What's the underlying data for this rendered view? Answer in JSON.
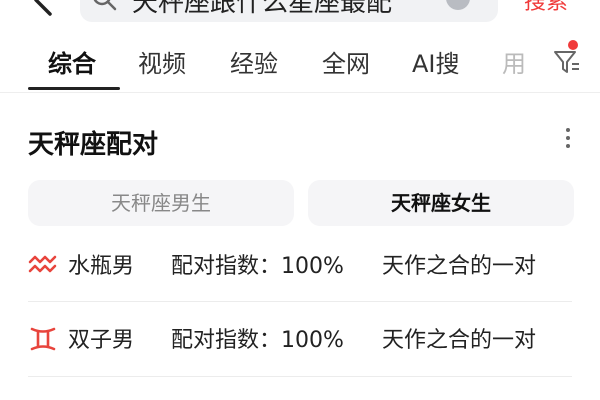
{
  "search": {
    "query": "天秤座跟什么星座最配",
    "button_label": "搜索"
  },
  "tabs": [
    {
      "label": "综合"
    },
    {
      "label": "视频"
    },
    {
      "label": "经验"
    },
    {
      "label": "全网"
    },
    {
      "label": "AI搜"
    },
    {
      "label": "用"
    }
  ],
  "card": {
    "title": "天秤座配对",
    "segments": [
      {
        "label": "天秤座男生",
        "selected": false
      },
      {
        "label": "天秤座女生",
        "selected": true
      }
    ],
    "rows": [
      {
        "icon": "aquarius-icon",
        "name": "水瓶男",
        "index": "配对指数：100%",
        "desc": "天作之合的一对"
      },
      {
        "icon": "gemini-icon",
        "name": "双子男",
        "index": "配对指数：100%",
        "desc": "天作之合的一对"
      }
    ]
  },
  "colors": {
    "accent_red": "#f03a3a",
    "icon_red": "#e8443c",
    "text_dark": "#222222"
  }
}
